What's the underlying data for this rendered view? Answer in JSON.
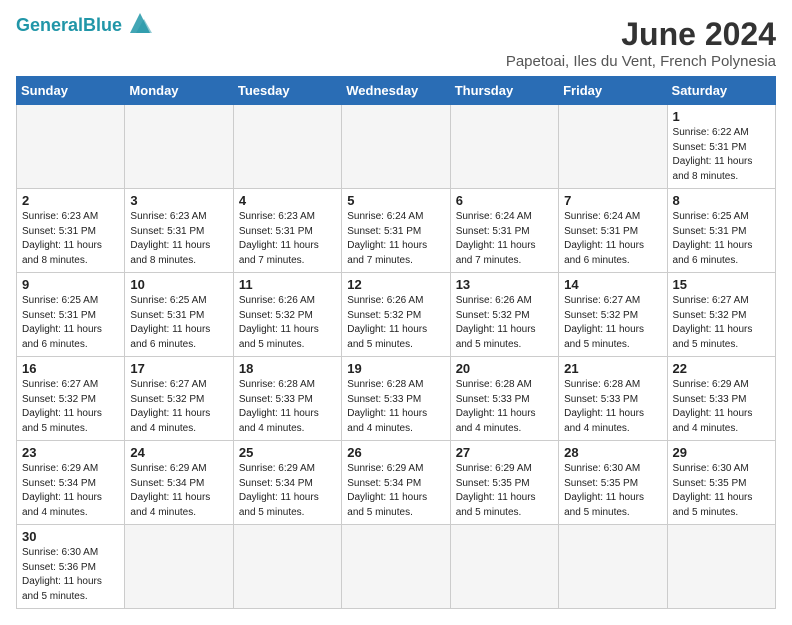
{
  "header": {
    "logo_general": "General",
    "logo_blue": "Blue",
    "month_year": "June 2024",
    "location": "Papetoai, Iles du Vent, French Polynesia"
  },
  "days_of_week": [
    "Sunday",
    "Monday",
    "Tuesday",
    "Wednesday",
    "Thursday",
    "Friday",
    "Saturday"
  ],
  "weeks": [
    [
      {
        "day": "",
        "info": ""
      },
      {
        "day": "",
        "info": ""
      },
      {
        "day": "",
        "info": ""
      },
      {
        "day": "",
        "info": ""
      },
      {
        "day": "",
        "info": ""
      },
      {
        "day": "",
        "info": ""
      },
      {
        "day": "1",
        "info": "Sunrise: 6:22 AM\nSunset: 5:31 PM\nDaylight: 11 hours\nand 8 minutes."
      }
    ],
    [
      {
        "day": "2",
        "info": "Sunrise: 6:23 AM\nSunset: 5:31 PM\nDaylight: 11 hours\nand 8 minutes."
      },
      {
        "day": "3",
        "info": "Sunrise: 6:23 AM\nSunset: 5:31 PM\nDaylight: 11 hours\nand 8 minutes."
      },
      {
        "day": "4",
        "info": "Sunrise: 6:23 AM\nSunset: 5:31 PM\nDaylight: 11 hours\nand 7 minutes."
      },
      {
        "day": "5",
        "info": "Sunrise: 6:24 AM\nSunset: 5:31 PM\nDaylight: 11 hours\nand 7 minutes."
      },
      {
        "day": "6",
        "info": "Sunrise: 6:24 AM\nSunset: 5:31 PM\nDaylight: 11 hours\nand 7 minutes."
      },
      {
        "day": "7",
        "info": "Sunrise: 6:24 AM\nSunset: 5:31 PM\nDaylight: 11 hours\nand 6 minutes."
      },
      {
        "day": "8",
        "info": "Sunrise: 6:25 AM\nSunset: 5:31 PM\nDaylight: 11 hours\nand 6 minutes."
      }
    ],
    [
      {
        "day": "9",
        "info": "Sunrise: 6:25 AM\nSunset: 5:31 PM\nDaylight: 11 hours\nand 6 minutes."
      },
      {
        "day": "10",
        "info": "Sunrise: 6:25 AM\nSunset: 5:31 PM\nDaylight: 11 hours\nand 6 minutes."
      },
      {
        "day": "11",
        "info": "Sunrise: 6:26 AM\nSunset: 5:32 PM\nDaylight: 11 hours\nand 5 minutes."
      },
      {
        "day": "12",
        "info": "Sunrise: 6:26 AM\nSunset: 5:32 PM\nDaylight: 11 hours\nand 5 minutes."
      },
      {
        "day": "13",
        "info": "Sunrise: 6:26 AM\nSunset: 5:32 PM\nDaylight: 11 hours\nand 5 minutes."
      },
      {
        "day": "14",
        "info": "Sunrise: 6:27 AM\nSunset: 5:32 PM\nDaylight: 11 hours\nand 5 minutes."
      },
      {
        "day": "15",
        "info": "Sunrise: 6:27 AM\nSunset: 5:32 PM\nDaylight: 11 hours\nand 5 minutes."
      }
    ],
    [
      {
        "day": "16",
        "info": "Sunrise: 6:27 AM\nSunset: 5:32 PM\nDaylight: 11 hours\nand 5 minutes."
      },
      {
        "day": "17",
        "info": "Sunrise: 6:27 AM\nSunset: 5:32 PM\nDaylight: 11 hours\nand 4 minutes."
      },
      {
        "day": "18",
        "info": "Sunrise: 6:28 AM\nSunset: 5:33 PM\nDaylight: 11 hours\nand 4 minutes."
      },
      {
        "day": "19",
        "info": "Sunrise: 6:28 AM\nSunset: 5:33 PM\nDaylight: 11 hours\nand 4 minutes."
      },
      {
        "day": "20",
        "info": "Sunrise: 6:28 AM\nSunset: 5:33 PM\nDaylight: 11 hours\nand 4 minutes."
      },
      {
        "day": "21",
        "info": "Sunrise: 6:28 AM\nSunset: 5:33 PM\nDaylight: 11 hours\nand 4 minutes."
      },
      {
        "day": "22",
        "info": "Sunrise: 6:29 AM\nSunset: 5:33 PM\nDaylight: 11 hours\nand 4 minutes."
      }
    ],
    [
      {
        "day": "23",
        "info": "Sunrise: 6:29 AM\nSunset: 5:34 PM\nDaylight: 11 hours\nand 4 minutes."
      },
      {
        "day": "24",
        "info": "Sunrise: 6:29 AM\nSunset: 5:34 PM\nDaylight: 11 hours\nand 4 minutes."
      },
      {
        "day": "25",
        "info": "Sunrise: 6:29 AM\nSunset: 5:34 PM\nDaylight: 11 hours\nand 5 minutes."
      },
      {
        "day": "26",
        "info": "Sunrise: 6:29 AM\nSunset: 5:34 PM\nDaylight: 11 hours\nand 5 minutes."
      },
      {
        "day": "27",
        "info": "Sunrise: 6:29 AM\nSunset: 5:35 PM\nDaylight: 11 hours\nand 5 minutes."
      },
      {
        "day": "28",
        "info": "Sunrise: 6:30 AM\nSunset: 5:35 PM\nDaylight: 11 hours\nand 5 minutes."
      },
      {
        "day": "29",
        "info": "Sunrise: 6:30 AM\nSunset: 5:35 PM\nDaylight: 11 hours\nand 5 minutes."
      }
    ],
    [
      {
        "day": "30",
        "info": "Sunrise: 6:30 AM\nSunset: 5:36 PM\nDaylight: 11 hours\nand 5 minutes."
      },
      {
        "day": "",
        "info": ""
      },
      {
        "day": "",
        "info": ""
      },
      {
        "day": "",
        "info": ""
      },
      {
        "day": "",
        "info": ""
      },
      {
        "day": "",
        "info": ""
      },
      {
        "day": "",
        "info": ""
      }
    ]
  ]
}
